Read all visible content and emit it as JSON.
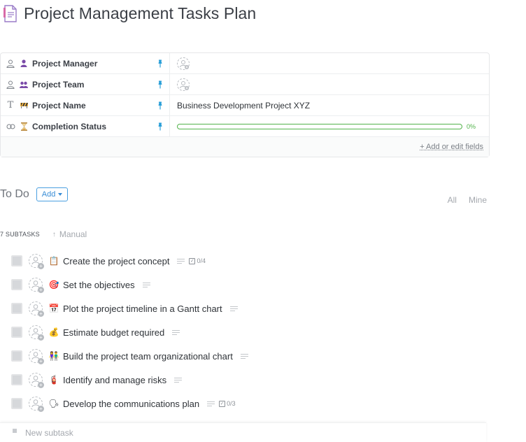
{
  "page": {
    "title": "Project Management Tasks Plan"
  },
  "fields": [
    {
      "name": "Project Manager",
      "type_icon": "user-icon",
      "emoji": "purple-person-emoji",
      "value": "",
      "value_kind": "people"
    },
    {
      "name": "Project Team",
      "type_icon": "user-icon",
      "emoji": "purple-people-emoji",
      "value": "",
      "value_kind": "people"
    },
    {
      "name": "Project Name",
      "type_icon": "text-icon",
      "emoji": "construction-emoji",
      "value": "Business Development Project XYZ",
      "value_kind": "text"
    },
    {
      "name": "Completion Status",
      "type_icon": "progress-icon",
      "emoji": "hourglass-emoji",
      "value": "0%",
      "value_kind": "progress",
      "progress_fraction": 0
    }
  ],
  "fields_footer": {
    "link": "+ Add or edit fields"
  },
  "todo": {
    "label": "To Do",
    "add_label": "Add",
    "filters": [
      "All",
      "Mine"
    ]
  },
  "subtasks": {
    "count_label": "7 SUBTASKS",
    "sort_label": "Manual",
    "items": [
      {
        "name": "Create the project concept",
        "emoji": "📋",
        "checklist": "0/4"
      },
      {
        "name": "Set the objectives",
        "emoji": "🎯",
        "checklist": ""
      },
      {
        "name": "Plot the project timeline in a Gantt chart",
        "emoji": "📅",
        "checklist": ""
      },
      {
        "name": "Estimate budget required",
        "emoji": "💰",
        "checklist": ""
      },
      {
        "name": "Build the project team organizational chart",
        "emoji": "👫",
        "checklist": ""
      },
      {
        "name": "Identify and manage risks",
        "emoji": "🧯",
        "checklist": ""
      },
      {
        "name": "Develop the communications plan",
        "emoji": "🗣",
        "checklist": "0/3"
      }
    ],
    "new_placeholder": "New subtask"
  },
  "colors": {
    "accent": "#3a8ed6",
    "progress": "#52b34a",
    "pin": "#2a9fd8",
    "doc_icon": "#8b5fbf"
  }
}
